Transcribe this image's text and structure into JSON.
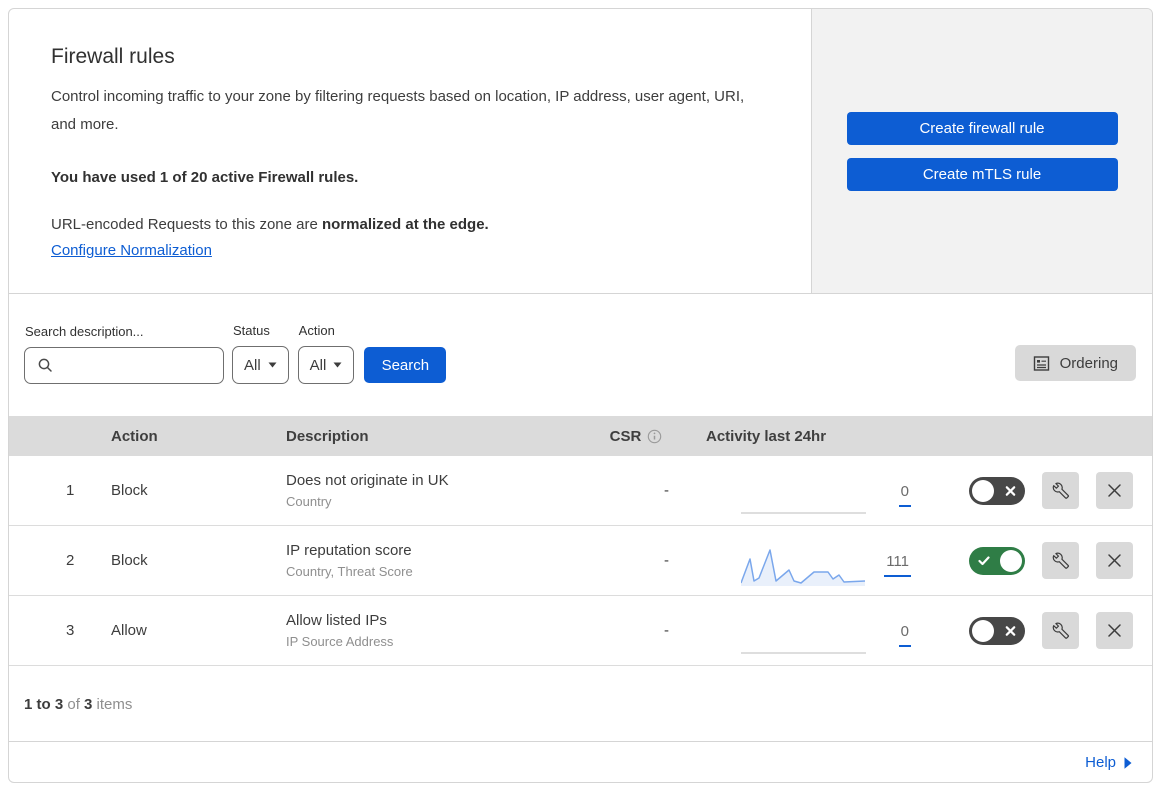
{
  "header": {
    "title": "Firewall rules",
    "description": "Control incoming traffic to your zone by filtering requests based on location, IP address, user agent, URI, and more.",
    "usage_note": "You have used 1 of 20 active Firewall rules.",
    "normalization_prefix": "URL-encoded Requests to this zone are ",
    "normalization_bold": "normalized at the edge.",
    "normalization_link": "Configure Normalization",
    "buttons": {
      "create_firewall_rule": "Create firewall rule",
      "create_mtls_rule": "Create mTLS rule"
    }
  },
  "filters": {
    "search_label": "Search description...",
    "search_value": "",
    "status_label": "Status",
    "status_value": "All",
    "action_label": "Action",
    "action_value": "All",
    "search_button": "Search",
    "ordering_button": "Ordering"
  },
  "table": {
    "columns": {
      "action": "Action",
      "description": "Description",
      "csr": "CSR",
      "activity": "Activity last 24hr"
    },
    "rows": [
      {
        "priority": "1",
        "action": "Block",
        "description": "Does not originate in UK",
        "fields": "Country",
        "csr": "-",
        "activity_count": "0",
        "enabled": false,
        "has_sparkline": false
      },
      {
        "priority": "2",
        "action": "Block",
        "description": "IP reputation score",
        "fields": "Country, Threat Score",
        "csr": "-",
        "activity_count": "111",
        "enabled": true,
        "has_sparkline": true,
        "sparkline_points": [
          [
            0,
            37
          ],
          [
            9,
            13
          ],
          [
            13,
            35
          ],
          [
            18,
            32
          ],
          [
            29,
            4
          ],
          [
            35,
            35
          ],
          [
            48,
            24
          ],
          [
            53,
            35
          ],
          [
            60,
            37
          ],
          [
            73,
            26
          ],
          [
            87,
            26
          ],
          [
            92,
            33
          ],
          [
            98,
            29
          ],
          [
            103,
            36
          ],
          [
            124,
            35
          ]
        ]
      },
      {
        "priority": "3",
        "action": "Allow",
        "description": "Allow listed IPs",
        "fields": "IP Source Address",
        "csr": "-",
        "activity_count": "0",
        "enabled": false,
        "has_sparkline": false
      }
    ]
  },
  "footer": {
    "range_bold": "1 to 3",
    "of_text": " of ",
    "total_bold": "3",
    "items_text": " items",
    "help_label": "Help"
  },
  "colors": {
    "accent_blue": "#0d5dd3",
    "toggle_on_green": "#2f7d46",
    "toggle_off_gray": "#474747",
    "sparkline_blue": "#7aa7ec",
    "sparkline_fill": "#e9f0fb",
    "flatline_gray": "#c9c9c9"
  }
}
